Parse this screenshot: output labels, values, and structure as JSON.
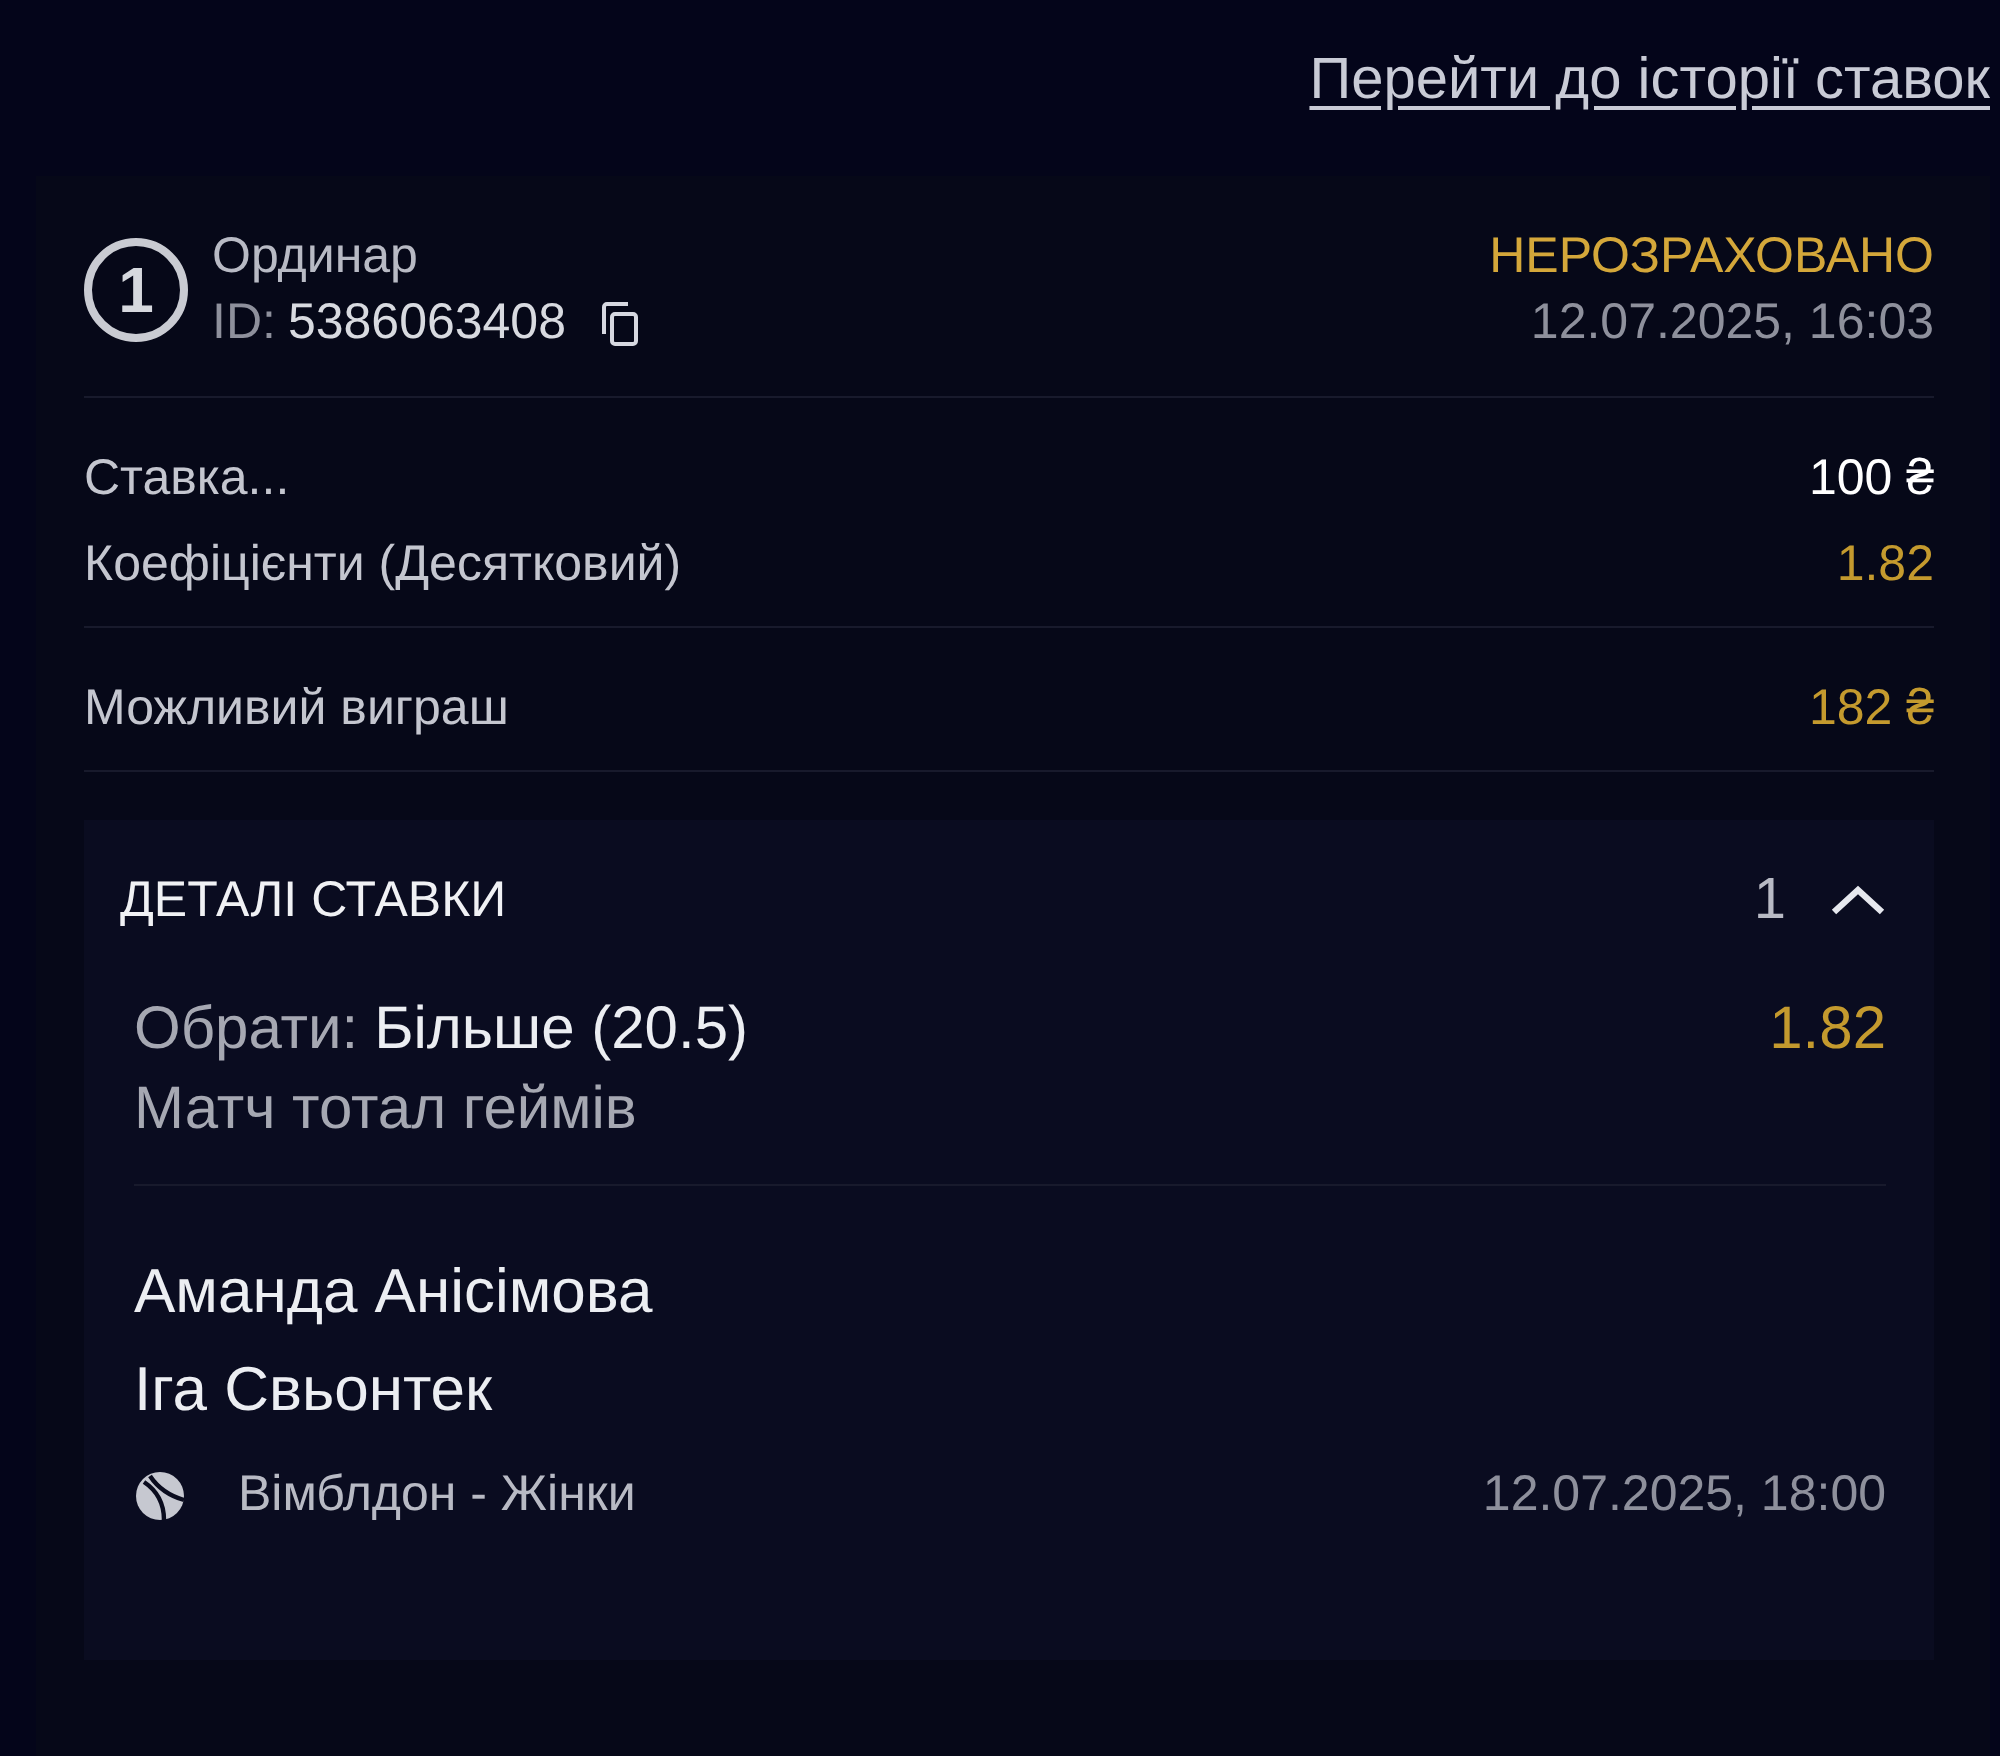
{
  "history_link": "Перейти до історії ставок",
  "bet": {
    "type_number": "1",
    "type": "Ординар",
    "id_label": "ID:",
    "id": "5386063408",
    "status": "НЕРОЗРАХОВАНО",
    "placed_at": "12.07.2025, 16:03"
  },
  "summary_groups": [
    [
      {
        "label": "Ставка...",
        "value": "100 ₴",
        "highlight": false
      },
      {
        "label": "Коефіцієнти (Десятковий)",
        "value": "1.82",
        "highlight": true
      }
    ],
    [
      {
        "label": "Можливий виграш",
        "value": "182 ₴",
        "highlight": true
      }
    ]
  ],
  "details": {
    "title": "ДЕТАЛІ СТАВКИ",
    "count": "1",
    "expanded": true,
    "selections": [
      {
        "pick_label": "Обрати:",
        "pick": "Більше (20.5)",
        "odds": "1.82",
        "market": "Матч тотал геймів",
        "players": [
          "Аманда Анісімова",
          "Іга Свьонтек"
        ],
        "tournament": "Вімблдон - Жінки",
        "start": "12.07.2025, 18:00"
      }
    ]
  }
}
